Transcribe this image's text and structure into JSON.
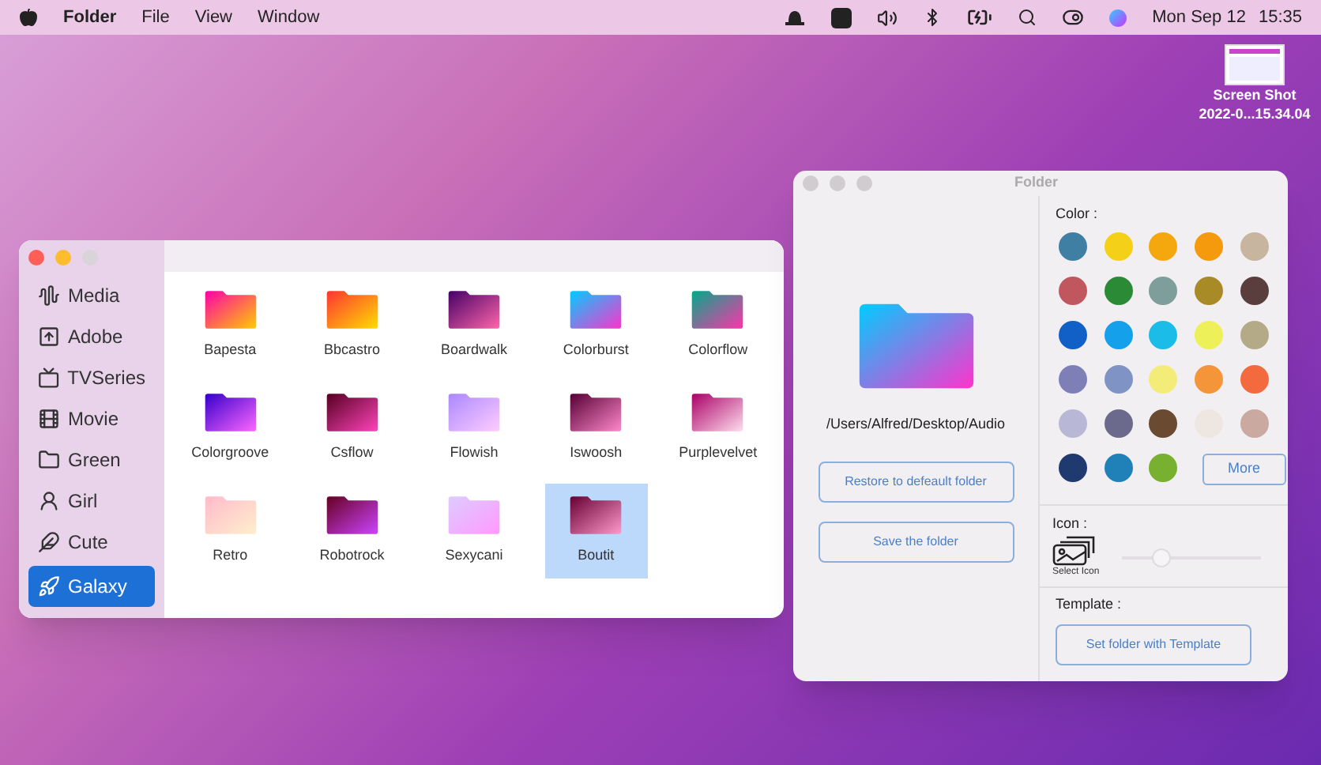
{
  "menu_bar": {
    "app_name": "Folder",
    "menus": [
      "File",
      "View",
      "Window"
    ],
    "date": "Mon Sep 12",
    "time": "15:35"
  },
  "desktop_file": {
    "name_lines": [
      "Screen Shot",
      "2022-0...15.34.04"
    ]
  },
  "library_window": {
    "sidebar": [
      {
        "label": "Media",
        "selected": false
      },
      {
        "label": "Adobe",
        "selected": false
      },
      {
        "label": "TVSeries",
        "selected": false
      },
      {
        "label": "Movie",
        "selected": false
      },
      {
        "label": "Green",
        "selected": false
      },
      {
        "label": "Girl",
        "selected": false
      },
      {
        "label": "Cute",
        "selected": false
      },
      {
        "label": "Galaxy",
        "selected": true
      }
    ],
    "folders": [
      {
        "label": "Bapesta",
        "selected": false
      },
      {
        "label": "Bbcastro",
        "selected": false
      },
      {
        "label": "Boardwalk",
        "selected": false
      },
      {
        "label": "Colorburst",
        "selected": false
      },
      {
        "label": "Colorflow",
        "selected": false
      },
      {
        "label": "Colorgroove",
        "selected": false
      },
      {
        "label": "Csflow",
        "selected": false
      },
      {
        "label": "Flowish",
        "selected": false
      },
      {
        "label": "Iswoosh",
        "selected": false
      },
      {
        "label": "Purplevelvet",
        "selected": false
      },
      {
        "label": "Retro",
        "selected": false
      },
      {
        "label": "Robotrock",
        "selected": false
      },
      {
        "label": "Sexycani",
        "selected": false
      },
      {
        "label": "Boutit",
        "selected": true
      }
    ]
  },
  "folder_window": {
    "title": "Folder",
    "path": "/Users/Alfred/Desktop/Audio",
    "buttons": [
      "Restore to defeault folder",
      "Save the folder"
    ],
    "color_label": "Color :",
    "colors": [
      {
        "color": "#3f7fa3"
      },
      {
        "color": "#f5d018"
      },
      {
        "color": "#f5a70e"
      },
      {
        "color": "#f59a0c"
      },
      {
        "color": "#c7b59f"
      },
      {
        "color": "#c0575e"
      },
      {
        "color": "#2a8a35"
      },
      {
        "color": "#7d9e9b"
      },
      {
        "color": "#a88a26"
      },
      {
        "color": "#5a3d3d"
      },
      {
        "color": "#1060c8"
      },
      {
        "color": "#14a0ea"
      },
      {
        "color": "#1bbde8"
      },
      {
        "color": "#eef05a"
      },
      {
        "color": "#b5aa88"
      },
      {
        "color": "#7f7fb8"
      },
      {
        "color": "#7f94c4"
      },
      {
        "color": "#f4ec78"
      },
      {
        "color": "#f39538"
      },
      {
        "color": "#f26a3d"
      },
      {
        "color": "#b8b8d6"
      },
      {
        "color": "#6c6a8c"
      },
      {
        "color": "#6a4a30"
      },
      {
        "color": "#eee6e0"
      },
      {
        "color": "#c9a9a0"
      },
      {
        "color": "#1e3a6e"
      },
      {
        "color": "#2080b8"
      },
      {
        "color": "#78b030"
      }
    ],
    "more_button": "More",
    "icon_label": "Icon :",
    "select_icon": "Select Icon",
    "icon_slider": {
      "level": 0.29
    },
    "template_label": "Template :",
    "template_button": "Set folder with Template"
  }
}
